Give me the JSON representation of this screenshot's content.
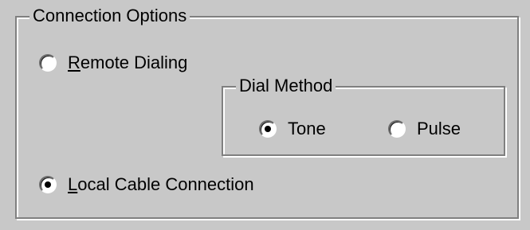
{
  "connection_options": {
    "title": "Connection Options",
    "remote_dialing": {
      "mnemonic": "R",
      "label_rest": "emote Dialing",
      "checked": false
    },
    "local_cable": {
      "mnemonic": "L",
      "label_rest": "ocal Cable Connection",
      "checked": true
    }
  },
  "dial_method": {
    "title": "Dial Method",
    "tone": {
      "label": "Tone",
      "checked": true
    },
    "pulse": {
      "label": "Pulse",
      "checked": false
    }
  }
}
